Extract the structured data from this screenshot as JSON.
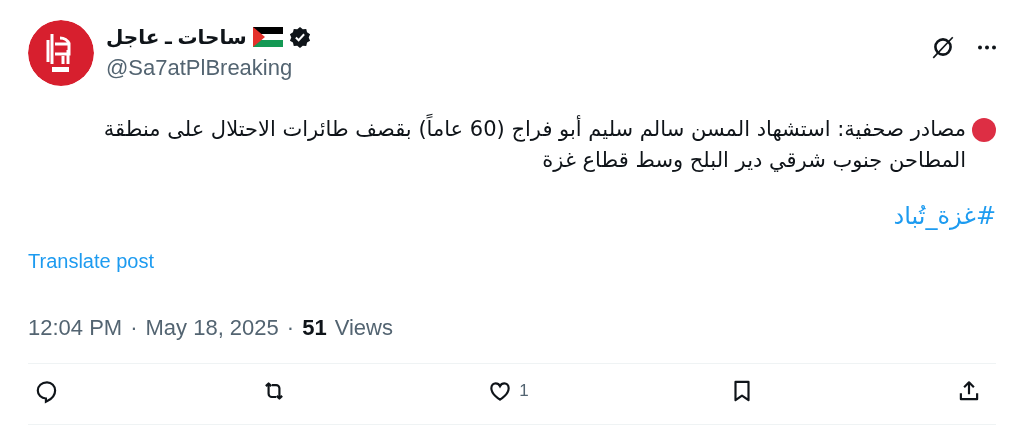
{
  "author": {
    "name": "ساحات ـ عاجل",
    "verified": true,
    "handle": "@Sa7atPlBreaking"
  },
  "post": {
    "text": "مصادر صحفية: استشهاد المسن سالم سليم أبو فراج (60 عاماً) بقصف طائرات الاحتلال على منطقة المطاحن جنوب شرقي دير البلح وسط قطاع غزة",
    "hashtag": "#غزة_تُباد"
  },
  "translate_link": "Translate post",
  "meta": {
    "time": "12:04 PM",
    "separator_1": "·",
    "date": "May 18, 2025",
    "separator_2": "·",
    "views_count": "51",
    "views_label": "Views"
  },
  "actions": [
    {
      "kind": "reply"
    },
    {
      "kind": "repost"
    },
    {
      "kind": "like",
      "count": "1"
    },
    {
      "kind": "bookmark"
    },
    {
      "kind": "share"
    }
  ]
}
